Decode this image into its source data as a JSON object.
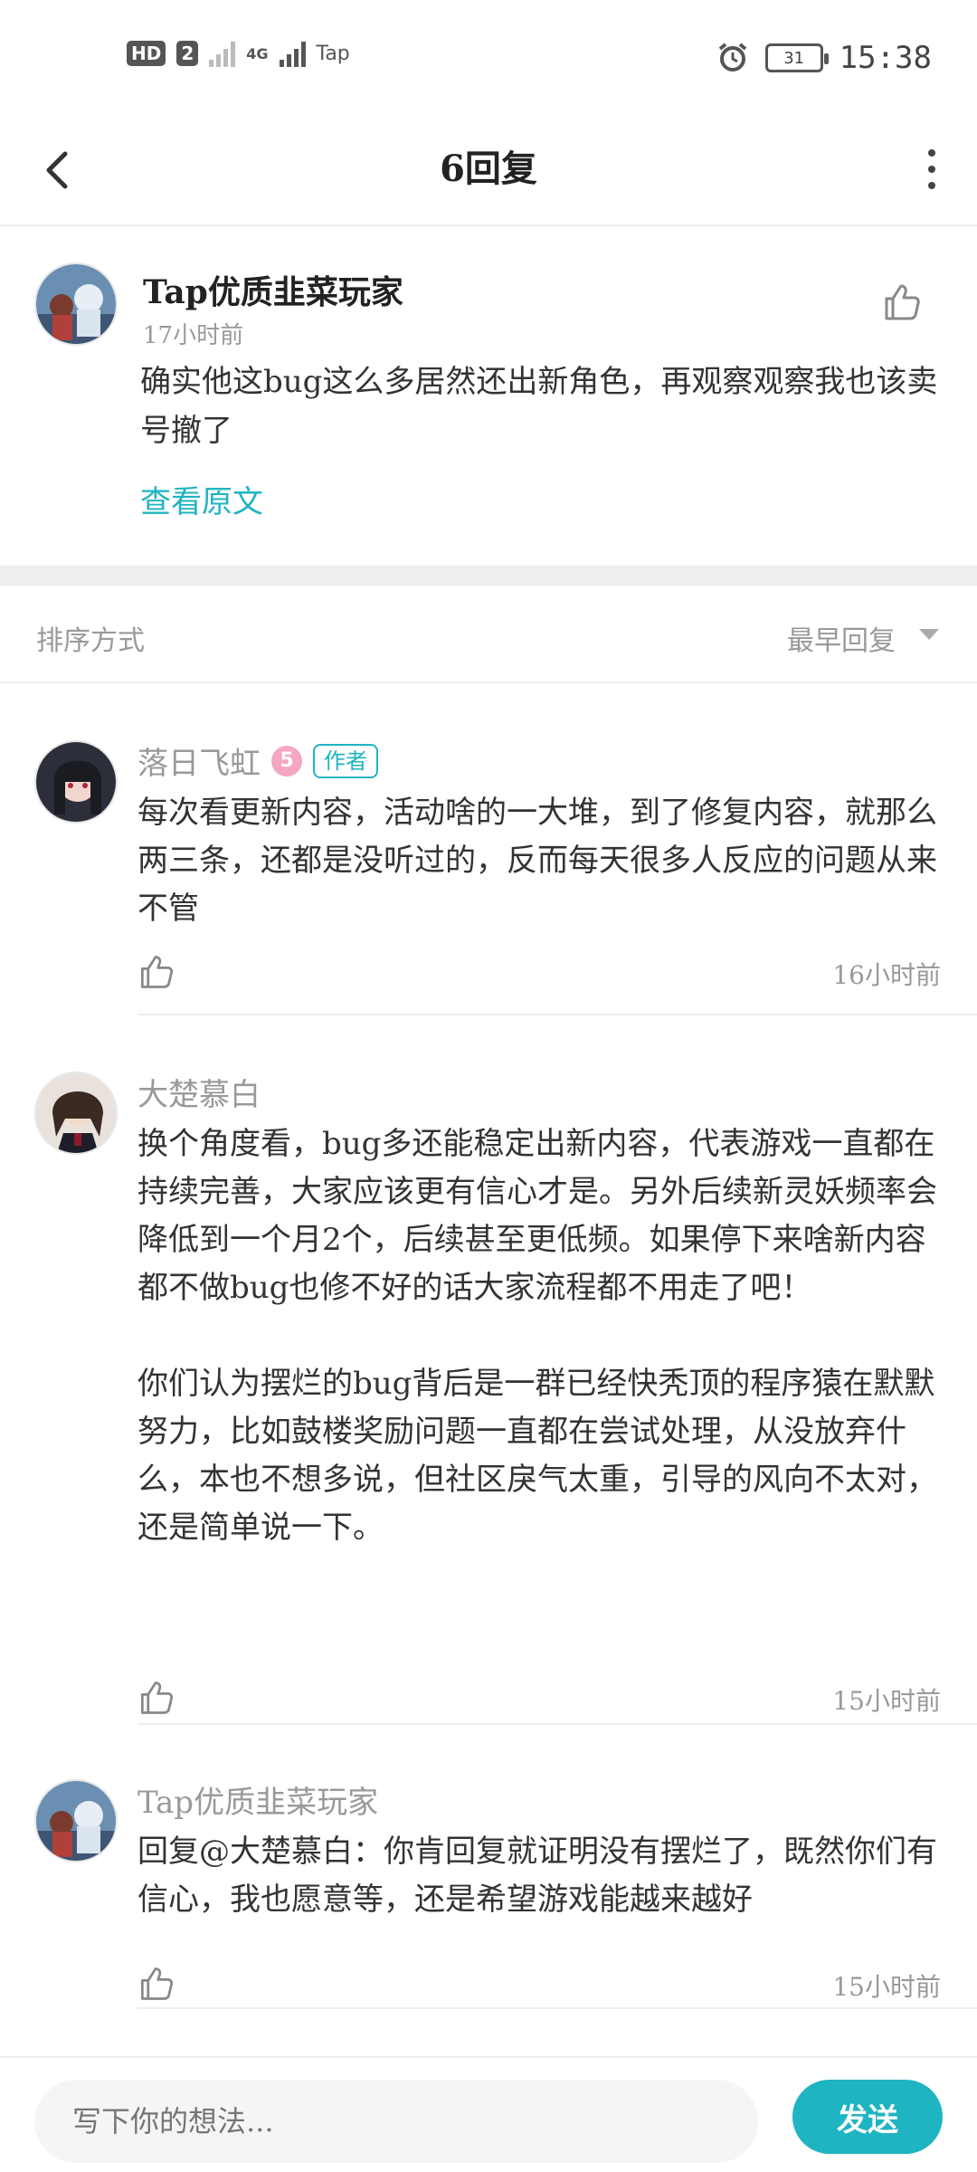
{
  "status_bar": {
    "hd_badge": "HD",
    "sim": "2",
    "net": "4G",
    "carrier": "Tap",
    "battery": "31",
    "time": "15:38"
  },
  "header": {
    "title": "6回复"
  },
  "post": {
    "author": "Tap优质韭菜玩家",
    "time": "17小时前",
    "text": "确实他这bug这么多居然还出新角色，再观察观察我也该卖号撤了",
    "view_original": "查看原文"
  },
  "sort": {
    "label": "排序方式",
    "value": "最早回复"
  },
  "replies": [
    {
      "author": "落日飞虹",
      "level": "5",
      "tag": "作者",
      "text": "每次看更新内容，活动啥的一大堆，到了修复内容，就那么两三条，还都是没听过的，反而每天很多人反应的问题从来不管",
      "time": "16小时前"
    },
    {
      "author": "大楚慕白",
      "text": "换个角度看，bug多还能稳定出新内容，代表游戏一直都在持续完善，大家应该更有信心才是。另外后续新灵妖频率会降低到一个月2个，后续甚至更低频。如果停下来啥新内容都不做bug也修不好的话大家流程都不用走了吧！\n\n你们认为摆烂的bug背后是一群已经快秃顶的程序猿在默默努力，比如鼓楼奖励问题一直都在尝试处理，从没放弃什么，本也不想多说，但社区戾气太重，引导的风向不太对，还是简单说一下。",
      "time": "15小时前"
    },
    {
      "author": "Tap优质韭菜玩家",
      "text": "回复@大楚慕白：你肯回复就证明没有摆烂了，既然你们有信心，我也愿意等，还是希望游戏能越来越好",
      "time": "15小时前"
    }
  ],
  "composer": {
    "placeholder": "写下你的想法...",
    "send": "发送"
  },
  "colors": {
    "accent": "#1fb4c2",
    "muted": "#999999",
    "band": "#eeeeee"
  }
}
